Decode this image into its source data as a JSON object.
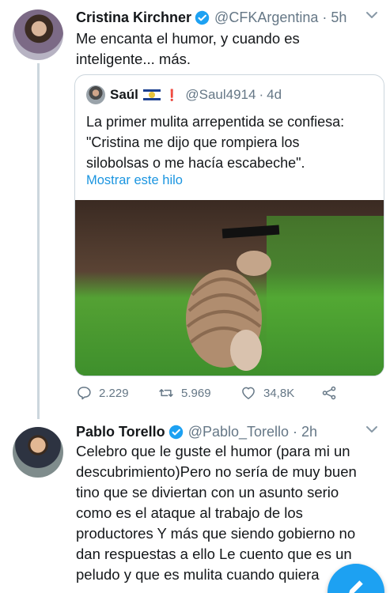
{
  "tweet1": {
    "name": "Cristina Kirchner",
    "handle": "@CFKArgentina",
    "separator": "·",
    "time": "5h",
    "text_line1": "Me encanta el humor, y cuando es",
    "text_line2": "inteligente... más.",
    "quoted": {
      "name": "Saúl",
      "handle": "@Saul4914",
      "separator": "·",
      "time": "4d",
      "text_line1": "La primer mulita arrepentida se confiesa:",
      "text_line2": "\"Cristina me dijo que rompiera los",
      "text_line3": "silobolsas o me hacía escabeche\".",
      "show_thread": "Mostrar este hilo"
    },
    "actions": {
      "replies": "2.229",
      "retweets": "5.969",
      "likes": "34,8K"
    }
  },
  "tweet2": {
    "name": "Pablo Torello",
    "handle": "@Pablo_Torello",
    "separator": "·",
    "time": "2h",
    "lines": [
      "Celebro que le guste el humor (para mi un",
      "descubrimiento)Pero no sería de muy buen",
      "tino que se diviertan con un asunto serio",
      "como es el ataque al trabajo de los",
      "productores Y más que siendo gobierno no",
      "dan respuestas a ello Le cuento que es un",
      "peludo y que es mulita cuando quiera"
    ]
  },
  "colors": {
    "accent": "#1da1f2",
    "link": "#1b95e0",
    "secondary_text": "#657786",
    "border": "#ccd6dd"
  },
  "icons": [
    "verified-badge-icon",
    "chevron-down-icon",
    "reply-icon",
    "retweet-icon",
    "like-icon",
    "share-icon",
    "compose-icon"
  ]
}
